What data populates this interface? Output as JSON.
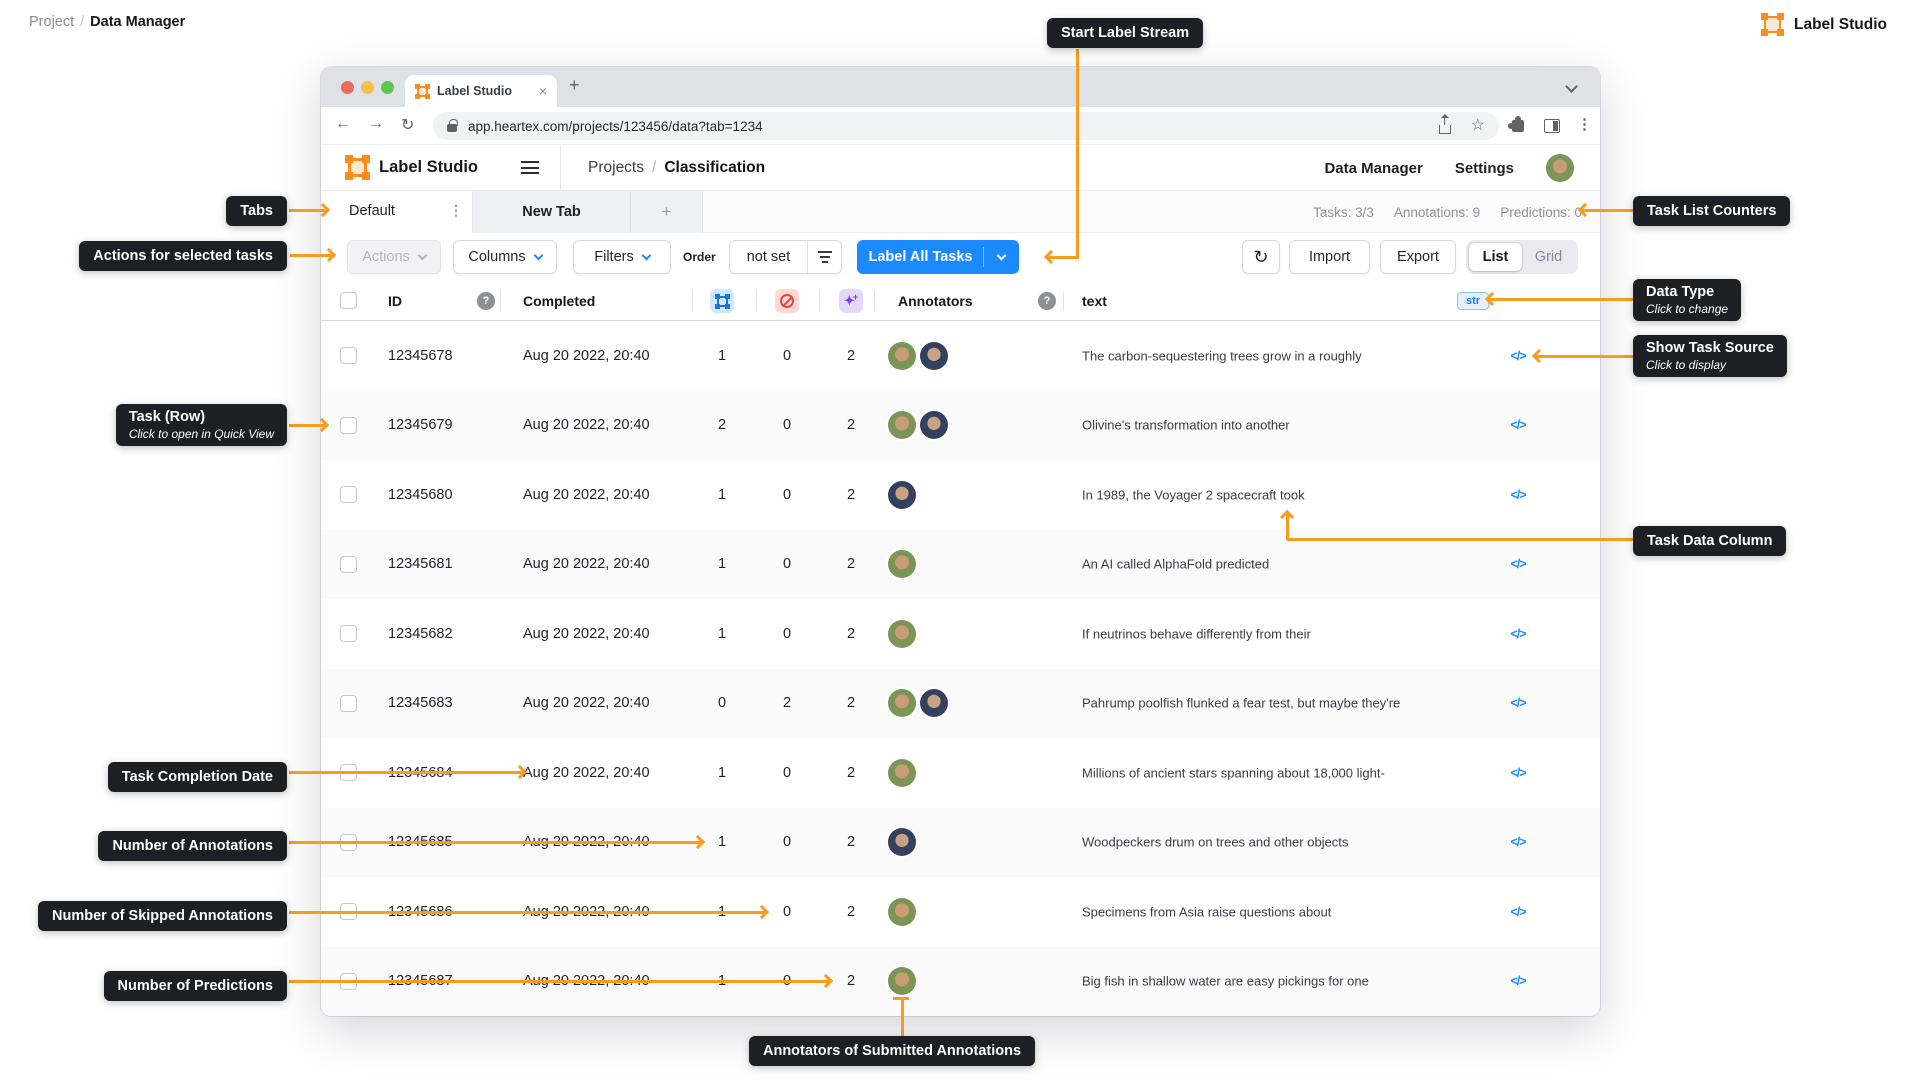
{
  "page": {
    "breadcrumb": {
      "project": "Project",
      "separator": "/",
      "current": "Data Manager"
    },
    "brand": {
      "name": "Label Studio"
    }
  },
  "browser": {
    "tab_title": "Label Studio",
    "url": "app.heartex.com/projects/123456/data?tab=1234"
  },
  "icons": {
    "tab_close": "×",
    "new_tab_plus": "+",
    "back": "←",
    "forward": "→",
    "reload": "↻",
    "star": "☆",
    "kebab": "⋮",
    "question": "?",
    "sparkles": "✦",
    "sparkle_plus": "+",
    "code": "</>"
  },
  "app": {
    "header": {
      "logo_text": "Label Studio",
      "breadcrumb": {
        "projects": "Projects",
        "separator": "/",
        "project_name": "Classification"
      },
      "nav": {
        "data_manager": "Data Manager",
        "settings": "Settings"
      }
    },
    "tabs": {
      "active": "Default",
      "inactive": "New Tab",
      "add": "+"
    },
    "counters": {
      "tasks": "Tasks: 3/3",
      "annotations": "Annotations: 9",
      "predictions": "Predictions: 0"
    },
    "toolbar": {
      "actions": "Actions",
      "columns": "Columns",
      "filters": "Filters",
      "order_label": "Order",
      "order_value": "not set",
      "label_all": "Label All Tasks",
      "import": "Import",
      "export": "Export",
      "view_list": "List",
      "view_grid": "Grid"
    },
    "table": {
      "headers": {
        "id": "ID",
        "completed": "Completed",
        "annotators": "Annotators",
        "text": "text",
        "data_type_badge": "str"
      },
      "rows": [
        {
          "id": "12345678",
          "completed": "Aug 20 2022, 20:40",
          "annotations": "1",
          "skipped": "0",
          "predictions": "2",
          "annotators": [
            "woman",
            "man"
          ],
          "text": "The carbon-sequestering trees grow in a roughly"
        },
        {
          "id": "12345679",
          "completed": "Aug 20 2022, 20:40",
          "annotations": "2",
          "skipped": "0",
          "predictions": "2",
          "annotators": [
            "woman",
            "man"
          ],
          "text": "Olivine's transformation into another"
        },
        {
          "id": "12345680",
          "completed": "Aug 20 2022, 20:40",
          "annotations": "1",
          "skipped": "0",
          "predictions": "2",
          "annotators": [
            "man"
          ],
          "text": "In 1989, the Voyager 2 spacecraft took"
        },
        {
          "id": "12345681",
          "completed": "Aug 20 2022, 20:40",
          "annotations": "1",
          "skipped": "0",
          "predictions": "2",
          "annotators": [
            "woman"
          ],
          "text": "An AI called AlphaFold predicted"
        },
        {
          "id": "12345682",
          "completed": "Aug 20 2022, 20:40",
          "annotations": "1",
          "skipped": "0",
          "predictions": "2",
          "annotators": [
            "woman"
          ],
          "text": "If neutrinos behave differently from their"
        },
        {
          "id": "12345683",
          "completed": "Aug 20 2022, 20:40",
          "annotations": "0",
          "skipped": "2",
          "predictions": "2",
          "annotators": [
            "woman",
            "man"
          ],
          "text": "Pahrump poolfish flunked a fear test, but maybe they're"
        },
        {
          "id": "12345684",
          "completed": "Aug 20 2022, 20:40",
          "annotations": "1",
          "skipped": "0",
          "predictions": "2",
          "annotators": [
            "woman"
          ],
          "text": "Millions of ancient stars spanning about 18,000 light-"
        },
        {
          "id": "12345685",
          "completed": "Aug 20 2022, 20:40",
          "annotations": "1",
          "skipped": "0",
          "predictions": "2",
          "annotators": [
            "man"
          ],
          "text": "Woodpeckers drum on trees and other objects"
        },
        {
          "id": "12345686",
          "completed": "Aug 20 2022, 20:40",
          "annotations": "1",
          "skipped": "0",
          "predictions": "2",
          "annotators": [
            "woman"
          ],
          "text": "Specimens from Asia raise questions about"
        },
        {
          "id": "12345687",
          "completed": "Aug 20 2022, 20:40",
          "annotations": "1",
          "skipped": "0",
          "predictions": "2",
          "annotators": [
            "woman"
          ],
          "text": "Big fish in shallow water are easy pickings for one"
        }
      ]
    }
  },
  "callouts": {
    "start_label_stream": "Start Label Stream",
    "tabs": "Tabs",
    "actions": "Actions for selected tasks",
    "task_list_counters": "Task List Counters",
    "data_type_title": "Data Type",
    "data_type_sub": "Click to change",
    "show_task_source_title": "Show Task Source",
    "show_task_source_sub": "Click to display",
    "task_row_title": "Task (Row)",
    "task_row_sub": "Click to open in Quick View",
    "task_data_column": "Task Data Column",
    "task_completion_date": "Task Completion Date",
    "number_of_annotations": "Number of Annotations",
    "number_of_skipped": "Number of Skipped Annotations",
    "number_of_predictions": "Number of Predictions",
    "annotators_submitted": "Annotators of Submitted Annotations"
  },
  "colors": {
    "accent_orange": "#F99B1D",
    "primary_blue": "#1B8AFF",
    "logo_orange": "#FF8A1E",
    "skip_red": "#E0493E",
    "predictions_purple": "#7C3AED",
    "badge_blue": "#1677FF",
    "callout_bg": "#1E1F24"
  }
}
